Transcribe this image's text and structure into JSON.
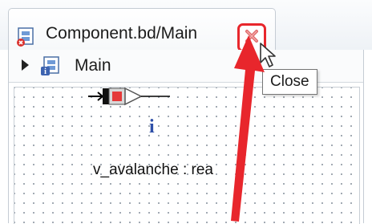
{
  "tab": {
    "title": "Component.bd/Main",
    "icon": "block-diagram-error-icon",
    "close_icon": "close-x-icon"
  },
  "breadcrumb": {
    "label": "Main",
    "icon": "block-diagram-info-icon"
  },
  "diagram": {
    "port_label": "v_avalanche : rea",
    "info_icon": "i"
  },
  "tooltip": {
    "text": "Close"
  },
  "colors": {
    "highlight": "#e8262c",
    "close_x": "#e06a6a",
    "info_blue": "#2e4fa8"
  }
}
